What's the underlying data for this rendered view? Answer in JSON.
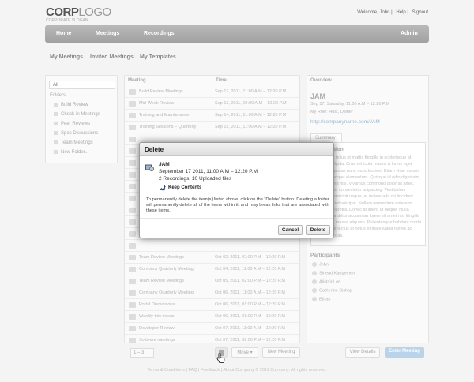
{
  "header": {
    "logo_part1": "CORP",
    "logo_part2": "LOGO",
    "tagline": "CORPORATE SLOGAN",
    "welcome": "Welcome, John",
    "help": "Help",
    "signout": "Signout"
  },
  "nav": {
    "home": "Home",
    "meetings": "Meetings",
    "recordings": "Recordings",
    "admin": "Admin"
  },
  "subnav": {
    "my_meetings": "My Meetings",
    "invited_meetings": "Invited Meetings",
    "my_templates": "My Templates"
  },
  "left": {
    "all": "All",
    "folders_title": "Folders",
    "folders": [
      "Build Review",
      "Check-in Meetings",
      "Peer Reviews",
      "Spec Discussions",
      "Team Meetings",
      "New Folder..."
    ]
  },
  "list": {
    "col_meeting": "Meeting",
    "col_time": "Time",
    "rows": [
      {
        "title": "Build Review Meetings",
        "time": "Sep 12, 2011, 11:00 A.M – 12:20 P.M"
      },
      {
        "title": "Mid-Week Review",
        "time": "Sep 13, 2011, 09:00 A.M – 12:20 P.M"
      },
      {
        "title": "Training and Maintenance",
        "time": "Sep 14, 2011, 11:00 A.M – 12:20 P.M"
      },
      {
        "title": "Training Sessions – Quarterly",
        "time": "Sep 15, 2011, 11:00 A.M – 12:20 P.M"
      },
      {
        "title": "",
        "time": ""
      },
      {
        "title": "",
        "time": ""
      },
      {
        "title": "",
        "time": ""
      },
      {
        "title": "",
        "time": ""
      },
      {
        "title": "",
        "time": ""
      },
      {
        "title": "",
        "time": ""
      },
      {
        "title": "",
        "time": ""
      },
      {
        "title": "",
        "time": ""
      },
      {
        "title": "",
        "time": ""
      },
      {
        "title": "",
        "time": ""
      },
      {
        "title": "Team Review Meetings",
        "time": "Oct 02, 2011, 02:00 P.M – 12:20 P.M"
      },
      {
        "title": "Company Quarterly Meeting",
        "time": "Oct 04, 2011, 11:00 A.M – 12:20 P.M"
      },
      {
        "title": "Team Review Meetings",
        "time": "Oct 05, 2011, 02:00 P.M – 12:20 P.M"
      },
      {
        "title": "Company Quarterly Meeting",
        "time": "Oct 06, 2011, 11:00 A.M – 12:20 P.M"
      },
      {
        "title": "Portal Discussions",
        "time": "Oct 06, 2011, 01:00 P.M – 12:20 P.M"
      },
      {
        "title": "Weekly this meets",
        "time": "Oct 06, 2011, 01:00 P.M – 12:20 P.M"
      },
      {
        "title": "Developer Review",
        "time": "Oct 07, 2011, 11:00 A.M – 12:20 P.M"
      },
      {
        "title": "Software meetings",
        "time": "Oct 07, 2011, 02:00 P.M – 12:20 P.M"
      }
    ],
    "pager": "1 – 3",
    "move": "Move ▾",
    "new_meeting": "New Meeting",
    "view_details": "View Details",
    "enter_meeting": "Enter Meeting"
  },
  "overview": {
    "title": "Overview",
    "name": "JAM",
    "datetime": "Sep 17, Saturday, 11:00 A.M – 12:20 P.M",
    "my_role_label": "My Role:",
    "my_role": "Host, Owner",
    "link": "http://companyname.com/JAM",
    "summary_tab": "Summary",
    "description_title": "Description",
    "description": "Nullam ac tellus ut mattis fringilla in scelerisque at tempor a ligula. Cras vehicula mauris a lorem eget lobortis egestas nunc nunc laoreet. Etiam vitae mauris in diam semper elementum. Quisque id odio dignissim, sed eleifend nisi. Vivamus commodo dolor sit amet, est congue, consectetur adipiscing. Vestibulum hendrerit suscipit neque, at malesuada mi tincidunt. Aliquam erat volutpat. Nullam fermentum ante non gravida pharetra. Donec at libero ut neque. Nulla facilisi. Curabitur accumsan lorem sit amet nisl fringilla et tempus massa aliquam. Pellentesque habitant morbi tristique senectus et netus et malesuada fames ac turpis egestas.",
    "participants_title": "Participants",
    "participants": [
      "John",
      "Sinead Kangemen",
      "Alistair Lee",
      "Catherine Bishop",
      "Ethan"
    ]
  },
  "footer": "Terms & Conditions | FAQ | Feedback | About Company     © 2011 Company. All rights reserved.",
  "dialog": {
    "title": "Delete",
    "item_name": "JAM",
    "item_date": "September 17 2011, 11:00 A.M – 12:20 P.M",
    "item_files": "2 Recordings, 10 Uploaded files",
    "keep_contents": "Keep Contents",
    "keep_checked": true,
    "warning": "To permanently delete the item(s) listed above, click on the “Delete” button. Deleting a folder will permanently delete all of the items within it, and may break links that are associated with these items.",
    "cancel": "Cancel",
    "delete": "Delete"
  }
}
